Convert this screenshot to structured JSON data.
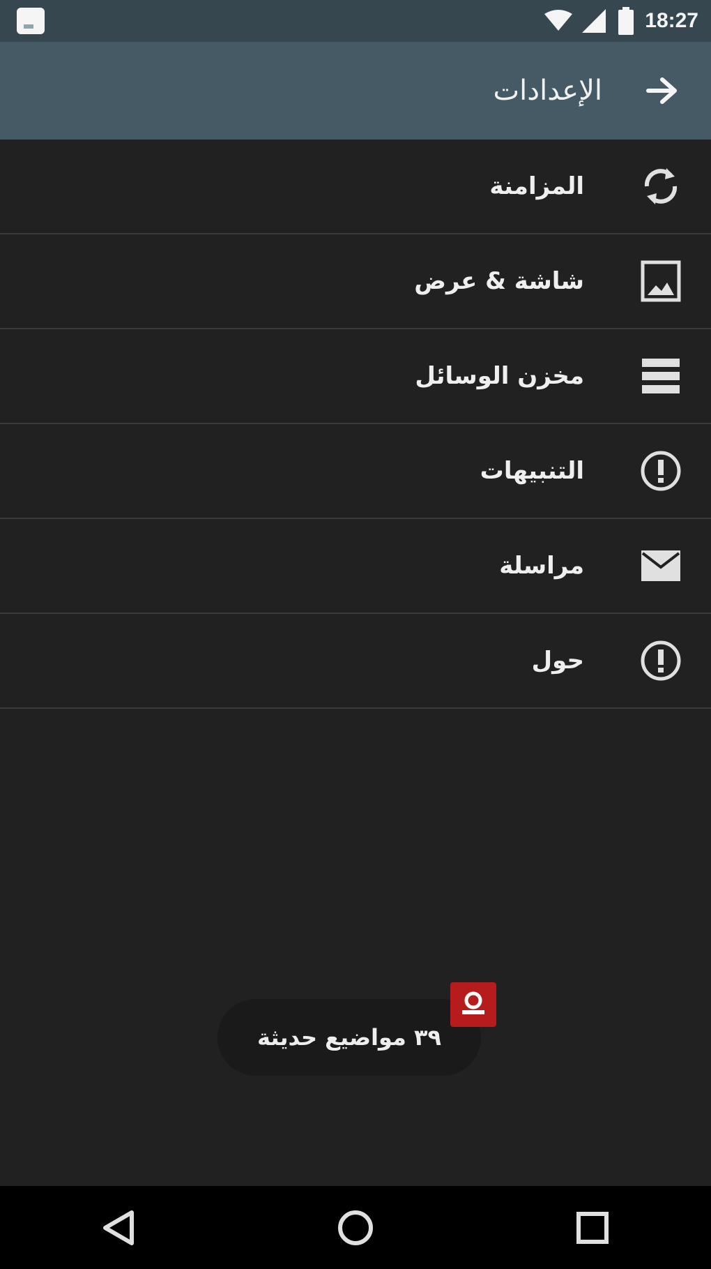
{
  "status_bar": {
    "time": "18:27",
    "icons": [
      "notification-icon",
      "wifi-icon",
      "cell-signal-icon",
      "battery-icon"
    ]
  },
  "toolbar": {
    "title": "الإعدادات",
    "back_icon": "arrow-forward-icon"
  },
  "menu": {
    "items": [
      {
        "label": "المزامنة",
        "icon": "sync-icon"
      },
      {
        "label": "شاشة & عرض",
        "icon": "image-icon"
      },
      {
        "label": "مخزن الوسائل",
        "icon": "storage-icon"
      },
      {
        "label": "التنبيهات",
        "icon": "info-icon"
      },
      {
        "label": "مراسلة",
        "icon": "mail-icon"
      },
      {
        "label": "حول",
        "icon": "info-icon"
      }
    ]
  },
  "toast": {
    "text": "٣٩ مواضيع حديثة",
    "badge_icon": "app-logo-icon"
  },
  "nav_bar": {
    "icons": [
      "back-icon",
      "home-icon",
      "recents-icon"
    ]
  },
  "colors": {
    "status_bar": "#37474f",
    "toolbar": "#455a64",
    "background": "#212121",
    "divider": "#3a3a3a",
    "toast": "#1a1a1a",
    "badge": "#b71c1c",
    "nav_bar": "#000000"
  }
}
